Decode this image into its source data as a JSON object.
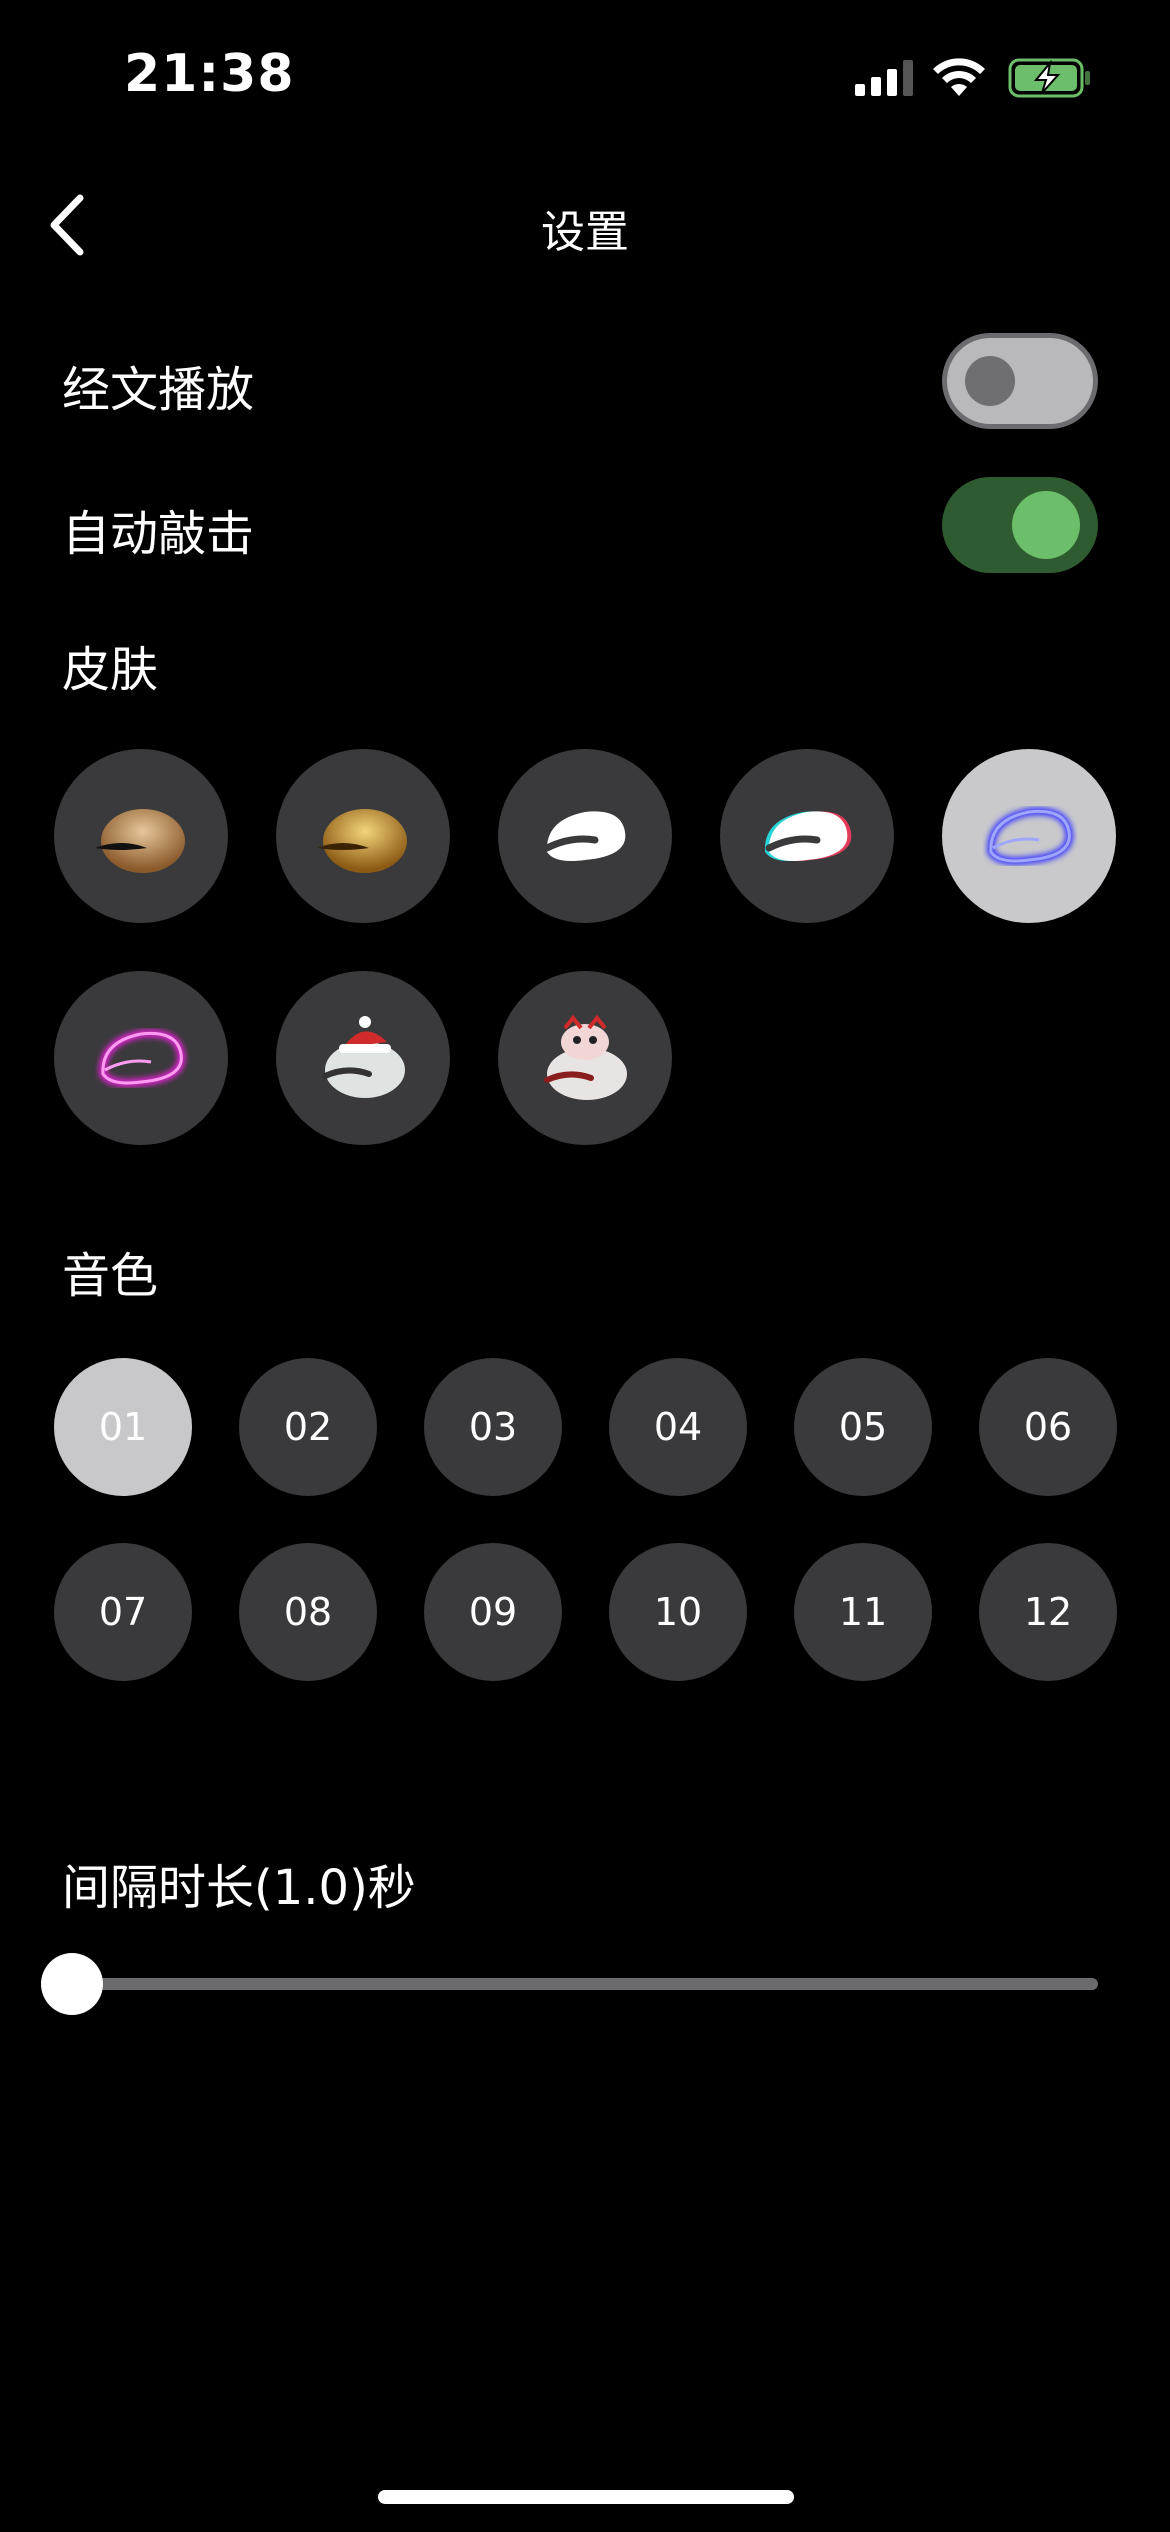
{
  "status": {
    "time": "21:38"
  },
  "nav": {
    "title": "设置"
  },
  "settings": {
    "scripture_play": {
      "label": "经文播放",
      "on": false
    },
    "auto_knock": {
      "label": "自动敲击",
      "on": true
    }
  },
  "skins": {
    "label": "皮肤",
    "items": [
      {
        "name": "wooden-fish-classic",
        "selected": false
      },
      {
        "name": "wooden-fish-gold",
        "selected": false
      },
      {
        "name": "wooden-fish-white",
        "selected": false
      },
      {
        "name": "wooden-fish-glitch",
        "selected": false
      },
      {
        "name": "wooden-fish-neon-blue",
        "selected": true
      },
      {
        "name": "wooden-fish-neon-pink",
        "selected": false
      },
      {
        "name": "wooden-fish-christmas",
        "selected": false
      },
      {
        "name": "wooden-fish-lion-dance",
        "selected": false
      }
    ]
  },
  "tones": {
    "label": "音色",
    "items": [
      "01",
      "02",
      "03",
      "04",
      "05",
      "06",
      "07",
      "08",
      "09",
      "10",
      "11",
      "12"
    ],
    "selected": "01"
  },
  "interval": {
    "label": "间隔时长(1.0)秒",
    "value": 1.0
  },
  "colors": {
    "toggle_on": "#2e5b2f",
    "toggle_on_knob": "#6cbe6a",
    "toggle_off": "#b9b9bb",
    "chip_bg": "#3a3a3c",
    "chip_selected": "#c9c9cb"
  }
}
